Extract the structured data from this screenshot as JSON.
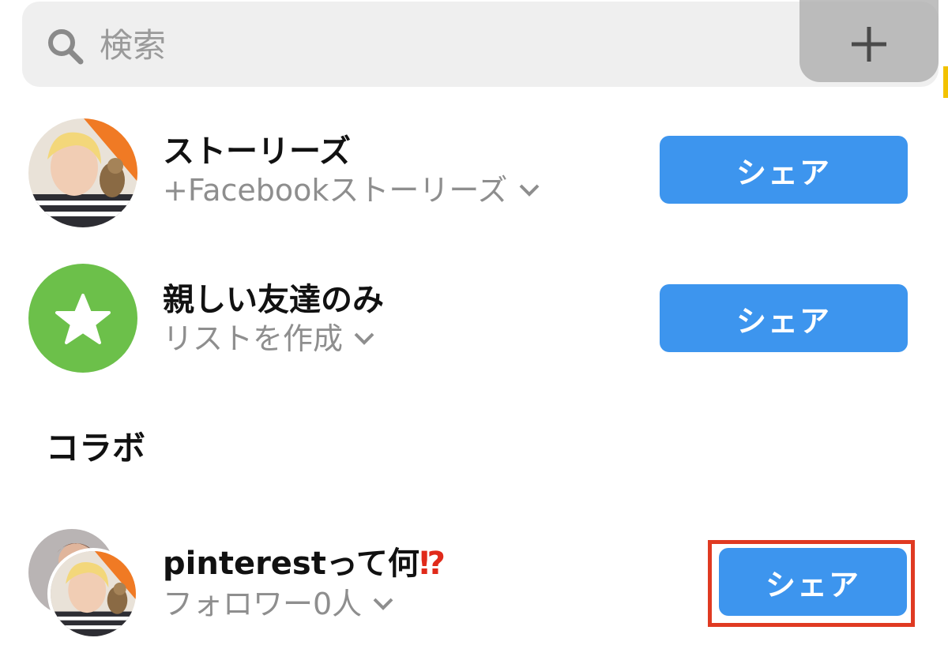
{
  "search": {
    "placeholder": "検索"
  },
  "rows": [
    {
      "title": "ストーリーズ",
      "subtitle": "+Facebookストーリーズ",
      "button": "シェア"
    },
    {
      "title": "親しい友達のみ",
      "subtitle": "リストを作成",
      "button": "シェア"
    }
  ],
  "collab": {
    "heading": "コラボ",
    "item": {
      "title": "pinterestって何",
      "title_mark": "⁉",
      "subtitle": "フォロワー0人",
      "button": "シェア"
    }
  },
  "colors": {
    "share_button": "#3d95ee",
    "close_friends_green": "#6cc04a",
    "highlight_red": "#e03a22",
    "story_ring_orange": "#f07a24"
  },
  "icons": [
    "search-icon",
    "plus-icon",
    "star-icon",
    "chevron-down-icon"
  ]
}
